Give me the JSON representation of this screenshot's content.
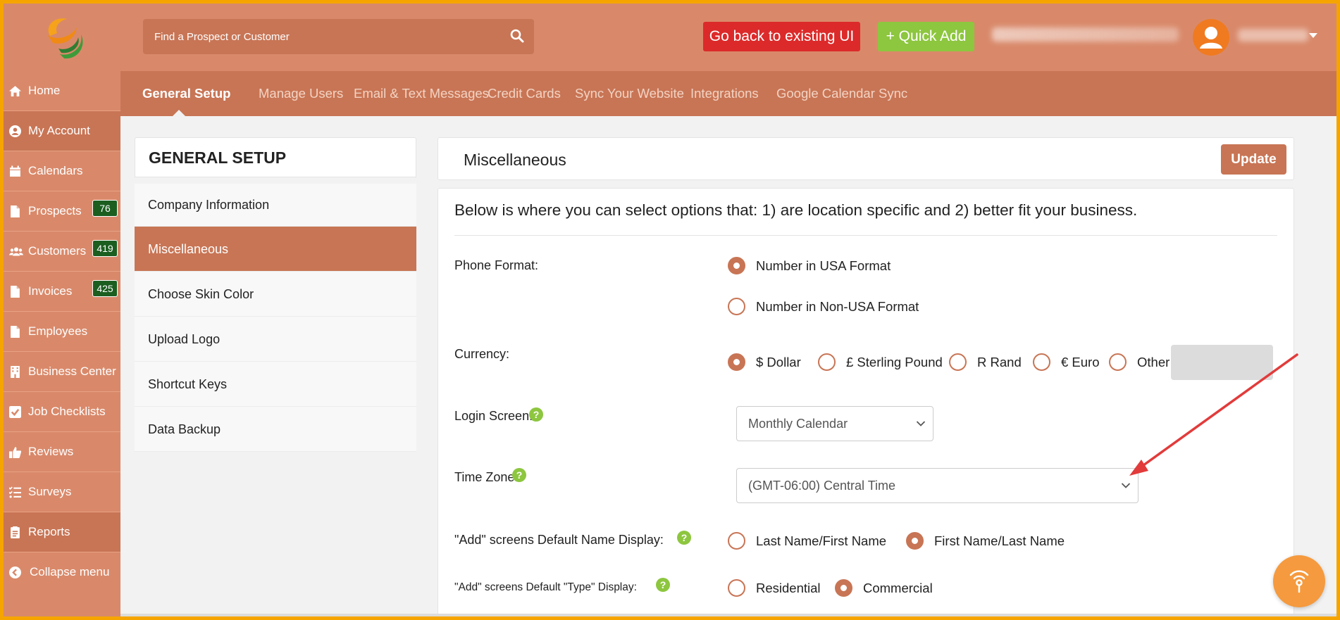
{
  "topbar": {
    "search_placeholder": "Find a Prospect or Customer",
    "back_button": "Go back to existing UI",
    "quick_add_button": "+ Quick Add"
  },
  "sidebar": {
    "items": [
      {
        "label": "Home",
        "icon": "home-icon"
      },
      {
        "label": "My Account",
        "icon": "user-circle-icon"
      },
      {
        "label": "Calendars",
        "icon": "calendar-icon"
      },
      {
        "label": "Prospects",
        "icon": "file-icon",
        "badge": "76"
      },
      {
        "label": "Customers",
        "icon": "users-icon",
        "badge": "419"
      },
      {
        "label": "Invoices",
        "icon": "file-icon",
        "badge": "425"
      },
      {
        "label": "Employees",
        "icon": "file-icon"
      },
      {
        "label": "Business Center",
        "icon": "building-icon"
      },
      {
        "label": "Job Checklists",
        "icon": "checkbox-icon"
      },
      {
        "label": "Reviews",
        "icon": "thumbs-up-icon"
      },
      {
        "label": "Surveys",
        "icon": "list-icon"
      },
      {
        "label": "Reports",
        "icon": "report-icon"
      },
      {
        "label": "Collapse menu",
        "icon": "chevron-left-icon"
      }
    ]
  },
  "tabs": [
    {
      "label": "General Setup",
      "active": true
    },
    {
      "label": "Manage Users"
    },
    {
      "label": "Email & Text Messages"
    },
    {
      "label": "Credit Cards"
    },
    {
      "label": "Sync Your Website"
    },
    {
      "label": "Integrations"
    },
    {
      "label": "Google Calendar Sync"
    }
  ],
  "setup_menu": {
    "title": "GENERAL SETUP",
    "items": [
      {
        "label": "Company Information"
      },
      {
        "label": "Miscellaneous",
        "active": true
      },
      {
        "label": "Choose Skin Color"
      },
      {
        "label": "Upload Logo"
      },
      {
        "label": "Shortcut Keys"
      },
      {
        "label": "Data Backup"
      }
    ]
  },
  "main": {
    "title": "Miscellaneous",
    "update_button": "Update",
    "intro": "Below is where you can select options that: 1) are location specific and 2) better fit your business.",
    "phone_format": {
      "label": "Phone Format:",
      "options": [
        "Number in USA Format",
        "Number in Non-USA Format"
      ],
      "selected": "Number in USA Format"
    },
    "currency": {
      "label": "Currency:",
      "options": [
        "$ Dollar",
        "£ Sterling Pound",
        "R Rand",
        "€ Euro",
        "Other"
      ],
      "selected": "$ Dollar"
    },
    "login_screen": {
      "label": "Login Screen:",
      "value": "Monthly Calendar"
    },
    "time_zone": {
      "label": "Time Zone:",
      "value": "(GMT-06:00) Central Time"
    },
    "name_display": {
      "label": "\"Add\" screens Default Name Display:",
      "options": [
        "Last Name/First Name",
        "First Name/Last Name"
      ],
      "selected": "First Name/Last Name"
    },
    "type_display": {
      "label": "\"Add\" screens Default \"Type\" Display:",
      "options": [
        "Residential",
        "Commercial"
      ],
      "selected": "Commercial"
    }
  },
  "colors": {
    "frame": "#f6a500",
    "header": "#d9896a",
    "accent": "#c87555",
    "badge": "#1b5e20",
    "back_button": "#dc2a2a",
    "quick_add": "#8dc63f",
    "help": "#8dc63f",
    "annotation_arrow": "#e23b3b"
  }
}
